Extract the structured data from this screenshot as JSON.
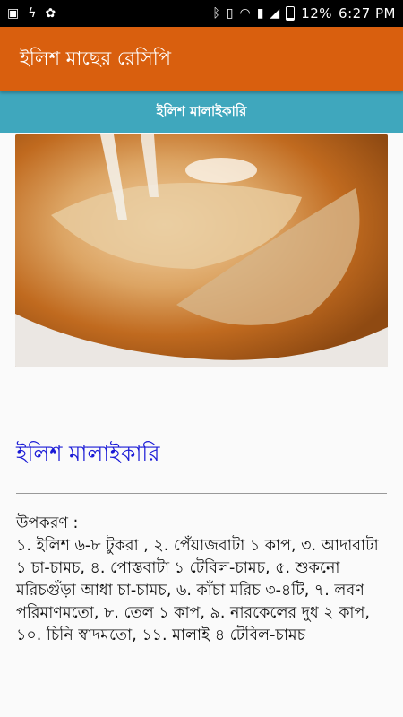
{
  "status_bar": {
    "battery_text": "12%",
    "time": "6:27 PM",
    "icons": [
      "image-icon",
      "flash-icon",
      "settings-icon",
      "bluetooth-icon",
      "vibrate-icon",
      "wifi-icon",
      "sim1-icon",
      "signal-icon",
      "battery-icon"
    ]
  },
  "app_bar": {
    "title": "ইলিশ মাছের রেসিপি",
    "color": "#d95f0e"
  },
  "sub_bar": {
    "title": "ইলিশ মালাইকারি",
    "color": "#3fa7bd"
  },
  "recipe": {
    "title": "ইলিশ মালাইকারি",
    "ingredients_label": "উপকরণ :",
    "ingredients_text": "১. ইলিশ ৬-৮ টুকরা , ২. পেঁয়াজবাটা ১ কাপ, ৩. আদাবাটা ১ চা-চামচ, ৪. পোস্তবাটা ১ টেবিল-চামচ, ৫. শুকনো মরিচগুঁড়া আধা চা-চামচ, ৬. কাঁচা মরিচ ৩-৪টি, ৭. লবণ পরিমাণমতো, ৮. তেল ১ কাপ, ৯. নারকেলের দুধ ২ কাপ, ১০. চিনি স্বাদমতো, ১১. মালাই ৪ টেবিল-চামচ",
    "title_color": "#1a1ad6"
  }
}
